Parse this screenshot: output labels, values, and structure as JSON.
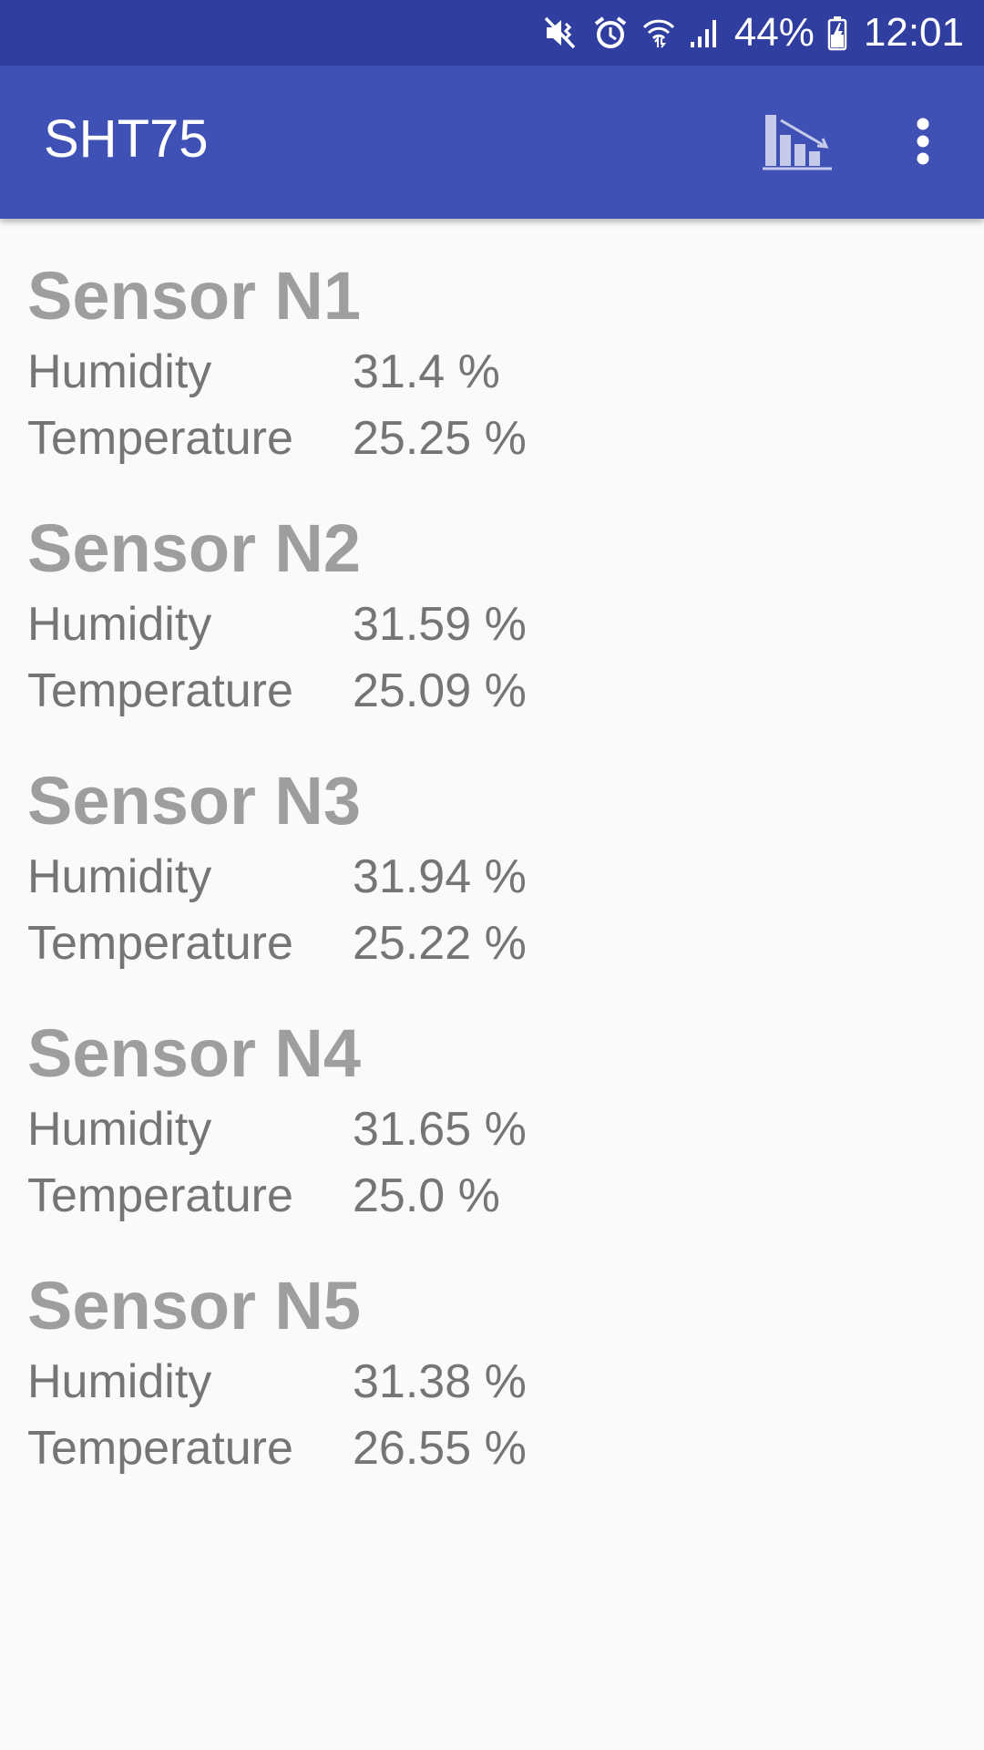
{
  "status_bar": {
    "battery_percent": "44%",
    "time": "12:01",
    "icons": [
      "mute-vibrate-icon",
      "alarm-icon",
      "wifi-icon",
      "signal-icon",
      "battery-charging-icon"
    ]
  },
  "app_bar": {
    "title": "SHT75",
    "actions": [
      "chart-icon",
      "more-vert-icon"
    ]
  },
  "sensors": [
    {
      "name": "Sensor N1",
      "humidity_label": "Humidity",
      "humidity": "31.4 %",
      "temperature_label": "Temperature",
      "temperature": "25.25 %"
    },
    {
      "name": "Sensor N2",
      "humidity_label": "Humidity",
      "humidity": "31.59 %",
      "temperature_label": "Temperature",
      "temperature": "25.09 %"
    },
    {
      "name": "Sensor N3",
      "humidity_label": "Humidity",
      "humidity": "31.94 %",
      "temperature_label": "Temperature",
      "temperature": "25.22 %"
    },
    {
      "name": "Sensor N4",
      "humidity_label": "Humidity",
      "humidity": "31.65 %",
      "temperature_label": "Temperature",
      "temperature": "25.0 %"
    },
    {
      "name": "Sensor N5",
      "humidity_label": "Humidity",
      "humidity": "31.38 %",
      "temperature_label": "Temperature",
      "temperature": "26.55 %"
    }
  ],
  "colors": {
    "status_bar": "#303f9f",
    "app_bar": "#3f51b5",
    "background": "#fafafa",
    "sensor_title": "#9e9e9e",
    "row_text": "#757575"
  }
}
